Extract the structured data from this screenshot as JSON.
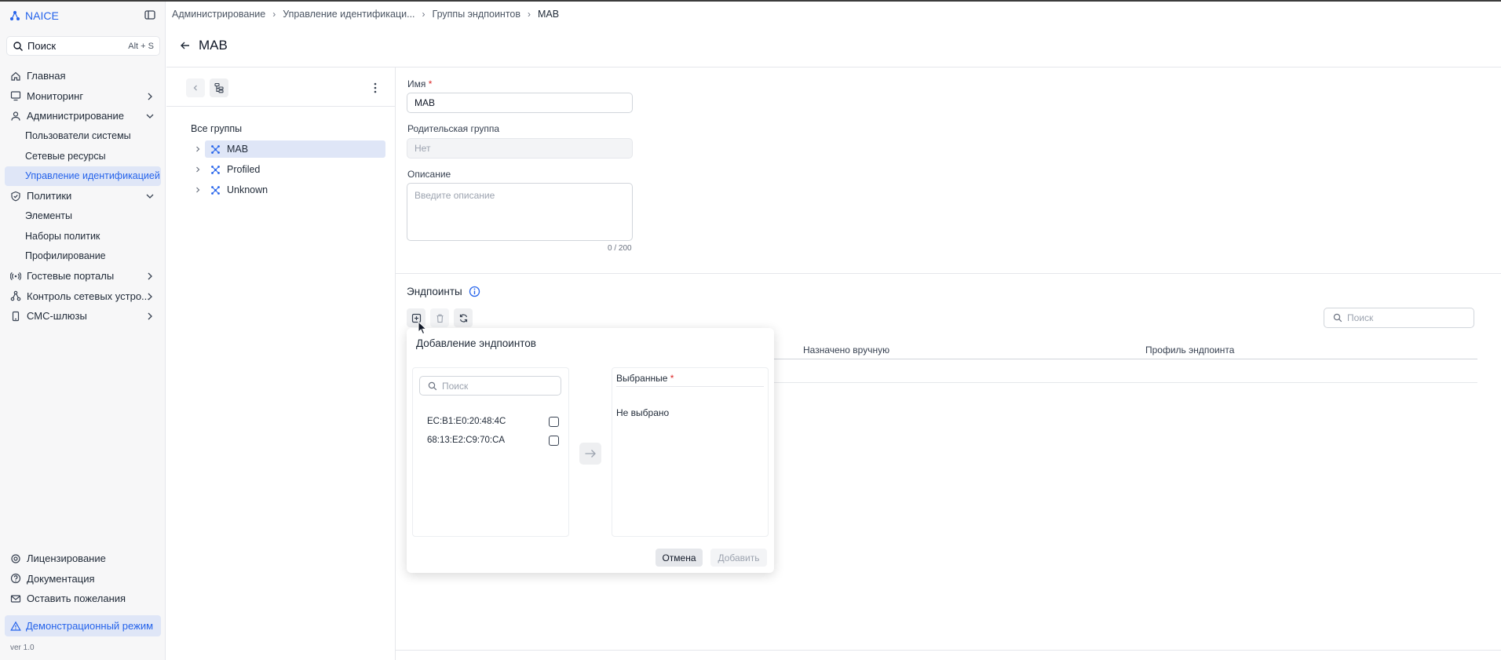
{
  "app": {
    "brand": "NAICE",
    "accent_color": "#2563eb",
    "version": "ver 1.0"
  },
  "sidebar": {
    "search_label": "Поиск",
    "search_shortcut": "Alt + S",
    "items": [
      {
        "label": "Главная",
        "icon": "home-icon"
      },
      {
        "label": "Мониторинг",
        "icon": "monitor-icon",
        "expandable": true
      },
      {
        "label": "Администрирование",
        "icon": "user-icon",
        "expanded": true,
        "children": [
          "Пользователи системы",
          "Сетевые ресурсы",
          "Управление идентификацией"
        ]
      },
      {
        "label": "Политики",
        "icon": "shield-check-icon",
        "expanded": true,
        "children": [
          "Элементы",
          "Наборы политик",
          "Профилирование"
        ]
      },
      {
        "label": "Гостевые порталы",
        "icon": "wifi-icon",
        "expandable": true
      },
      {
        "label": "Контроль сетевых устро...",
        "icon": "network-icon",
        "expandable": true
      },
      {
        "label": "СМС-шлюзы",
        "icon": "phone-icon",
        "expandable": true
      }
    ],
    "active_item": "Управление идентификацией",
    "bottom": [
      {
        "label": "Лицензирование",
        "icon": "license-icon"
      },
      {
        "label": "Документация",
        "icon": "help-icon"
      },
      {
        "label": "Оставить пожелания",
        "icon": "mail-icon"
      }
    ],
    "demo_mode": "Демонстрационный режим"
  },
  "breadcrumbs": [
    "Администрирование",
    "Управление идентификаци...",
    "Группы эндпоинтов",
    "MAB"
  ],
  "page": {
    "title": "MAB"
  },
  "tree": {
    "root_label": "Все группы",
    "items": [
      {
        "label": "MAB",
        "selected": true
      },
      {
        "label": "Profiled",
        "selected": false
      },
      {
        "label": "Unknown",
        "selected": false
      }
    ]
  },
  "form": {
    "name_label": "Имя",
    "name_required": "*",
    "name_value": "MAB",
    "parent_label": "Родительская группа",
    "parent_value": "Нет",
    "description_label": "Описание",
    "description_placeholder": "Введите описание",
    "description_counter": "0 / 200"
  },
  "endpoints": {
    "section_title": "Эндпоинты",
    "search_placeholder": "Поиск",
    "columns": [
      "Назначено вручную",
      "Профиль эндпоинта"
    ]
  },
  "add_dialog": {
    "title": "Добавление эндпоинтов",
    "search_placeholder": "Поиск",
    "available": [
      {
        "mac": "EC:B1:E0:20:48:4C",
        "checked": false
      },
      {
        "mac": "68:13:E2:C9:70:CA",
        "checked": false
      }
    ],
    "selected_label": "Выбранные",
    "selected_required": "*",
    "selected_empty": "Не выбрано",
    "cancel_label": "Отмена",
    "add_label": "Добавить"
  }
}
